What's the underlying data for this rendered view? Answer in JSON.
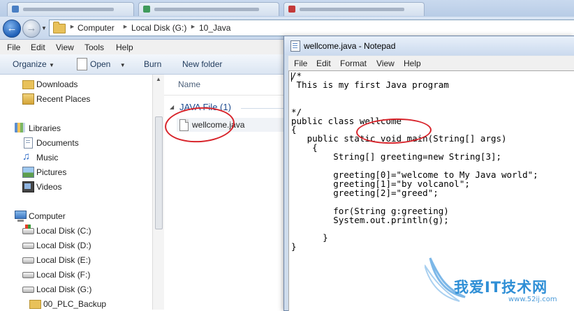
{
  "explorer": {
    "breadcrumb": [
      "Computer",
      "Local Disk (G:)",
      "10_Java"
    ],
    "menu": [
      "File",
      "Edit",
      "View",
      "Tools",
      "Help"
    ],
    "toolbar": {
      "organize": "Organize",
      "open": "Open",
      "burn": "Burn",
      "new_folder": "New folder"
    },
    "nav": {
      "favorites": [
        "Downloads",
        "Recent Places"
      ],
      "libraries": "Libraries",
      "library_items": [
        "Documents",
        "Music",
        "Pictures",
        "Videos"
      ],
      "computer": "Computer",
      "drives": [
        "Local Disk (C:)",
        "Local Disk (D:)",
        "Local Disk (E:)",
        "Local Disk (F:)",
        "Local Disk (G:)"
      ],
      "subfolder": "00_PLC_Backup"
    },
    "content": {
      "column_name": "Name",
      "group_header": "JAVA File (1)",
      "file": "wellcome.java"
    }
  },
  "notepad": {
    "title": "wellcome.java - Notepad",
    "menu": [
      "File",
      "Edit",
      "Format",
      "View",
      "Help"
    ],
    "code": "/*\n This is my first Java program\n\n\n*/\npublic class wellcome\n{\n   public static void main(String[] args)\n    {\n        String[] greeting=new String[3];\n\n        greeting[0]=\"welcome to My Java world\";\n        greeting[1]=\"by volcanol\";\n        greeting[2]=\"greed\";\n\n        for(String g:greeting)\n        System.out.println(g);\n\n      }\n}"
  },
  "watermark": {
    "title": "我爱IT技术网",
    "url": "www.52ij.com"
  },
  "colors": {
    "annotation": "#d8242b",
    "accent": "#1e4b8f"
  }
}
